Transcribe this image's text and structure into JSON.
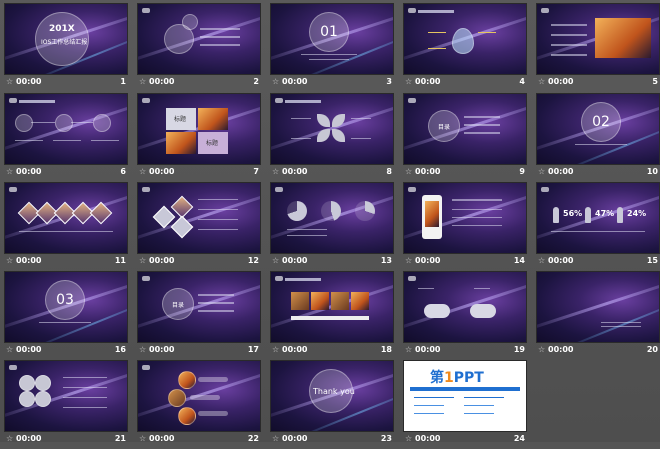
{
  "slides": [
    {
      "time": "00:00",
      "num": "1",
      "title": "201X",
      "subtitle": "IOS工作总结汇报"
    },
    {
      "time": "00:00",
      "num": "2"
    },
    {
      "time": "00:00",
      "num": "3",
      "label": "01"
    },
    {
      "time": "00:00",
      "num": "4"
    },
    {
      "time": "00:00",
      "num": "5"
    },
    {
      "time": "00:00",
      "num": "6"
    },
    {
      "time": "00:00",
      "num": "7",
      "labels": [
        "标题",
        "标题"
      ]
    },
    {
      "time": "00:00",
      "num": "8"
    },
    {
      "time": "00:00",
      "num": "9",
      "label": "目录"
    },
    {
      "time": "00:00",
      "num": "10",
      "label": "02"
    },
    {
      "time": "00:00",
      "num": "11"
    },
    {
      "time": "00:00",
      "num": "12"
    },
    {
      "time": "00:00",
      "num": "13"
    },
    {
      "time": "00:00",
      "num": "14"
    },
    {
      "time": "00:00",
      "num": "15",
      "stats": [
        "56%",
        "47%",
        "24%"
      ]
    },
    {
      "time": "00:00",
      "num": "16",
      "label": "03"
    },
    {
      "time": "00:00",
      "num": "17",
      "label": "目录"
    },
    {
      "time": "00:00",
      "num": "18"
    },
    {
      "time": "00:00",
      "num": "19"
    },
    {
      "time": "00:00",
      "num": "20"
    },
    {
      "time": "00:00",
      "num": "21"
    },
    {
      "time": "00:00",
      "num": "22"
    },
    {
      "time": "00:00",
      "num": "23",
      "label": "Thank you"
    },
    {
      "time": "00:00",
      "num": "24",
      "brand_a": "第",
      "brand_b": "1",
      "brand_c": "PPT"
    }
  ],
  "star_glyph": "☆",
  "colors": {
    "accent_blue": "#1f6fd0",
    "accent_orange": "#f08a1c"
  }
}
